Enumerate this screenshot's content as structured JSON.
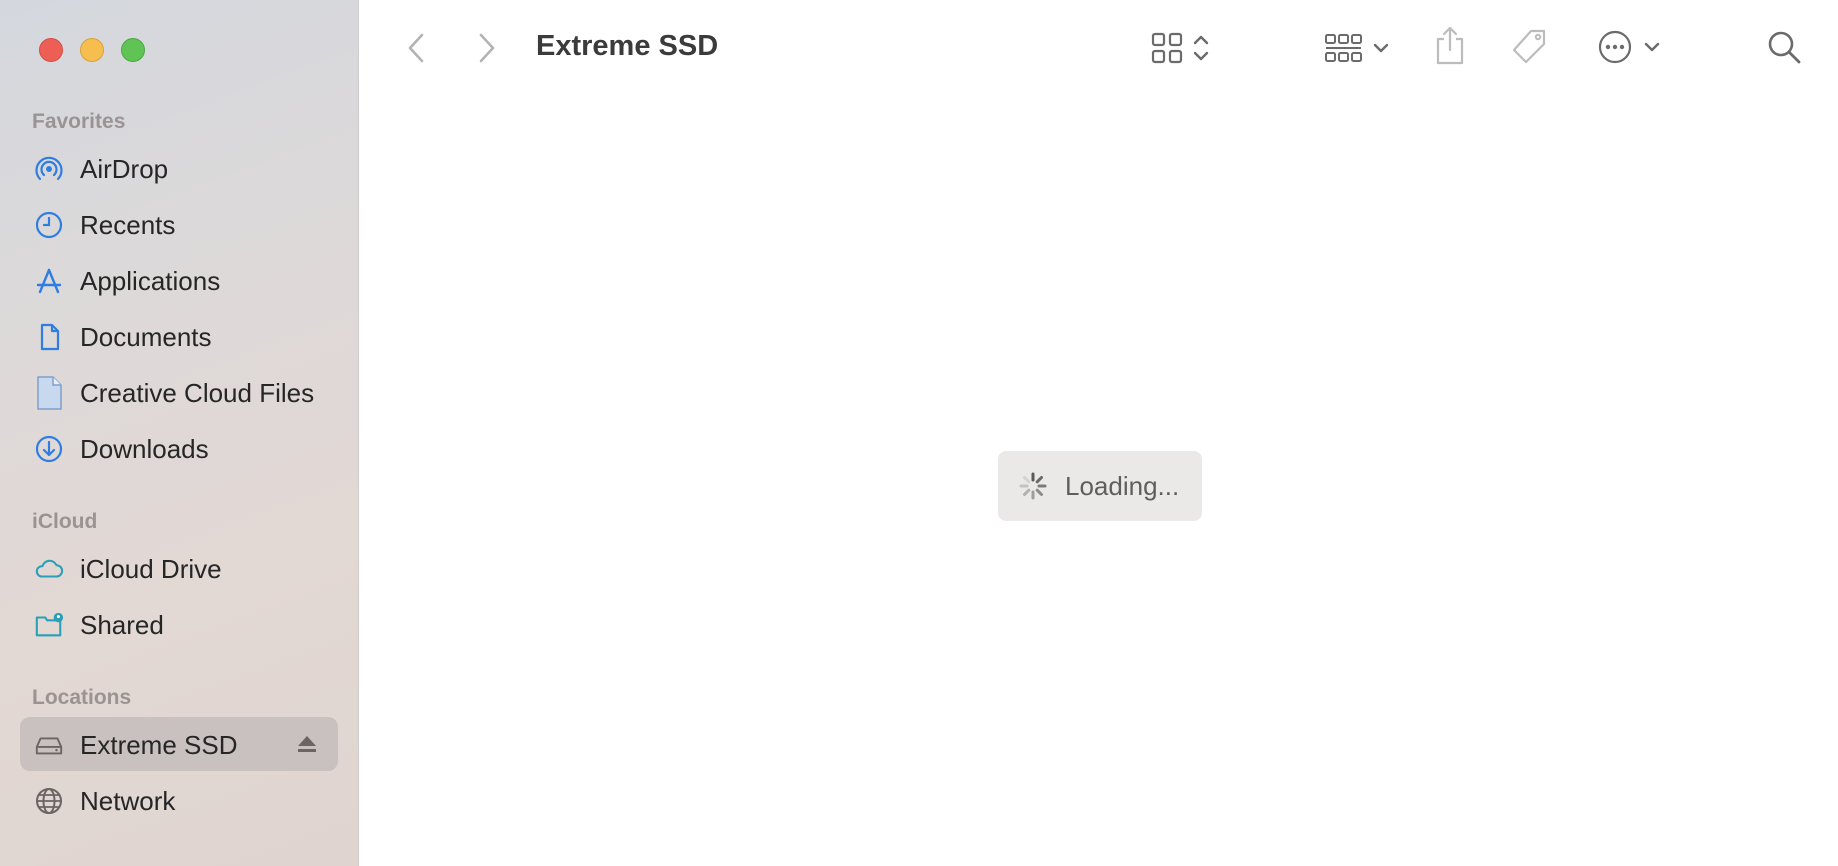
{
  "window": {
    "title": "Extreme SSD"
  },
  "sidebar": {
    "sections": {
      "favorites": "Favorites",
      "icloud": "iCloud",
      "locations": "Locations"
    },
    "favorites": [
      {
        "label": "AirDrop",
        "icon": "airdrop-icon"
      },
      {
        "label": "Recents",
        "icon": "clock-icon"
      },
      {
        "label": "Applications",
        "icon": "applications-icon"
      },
      {
        "label": "Documents",
        "icon": "document-icon"
      },
      {
        "label": "Creative Cloud Files",
        "icon": "file-icon"
      },
      {
        "label": "Downloads",
        "icon": "download-icon"
      }
    ],
    "icloud": [
      {
        "label": "iCloud Drive",
        "icon": "cloud-icon"
      },
      {
        "label": "Shared",
        "icon": "shared-folder-icon"
      }
    ],
    "locations": [
      {
        "label": "Extreme SSD",
        "icon": "drive-icon",
        "selected": true
      },
      {
        "label": "Network",
        "icon": "globe-icon"
      }
    ]
  },
  "main": {
    "loading_text": "Loading..."
  },
  "colors": {
    "accent": "#2f7de1",
    "selected_bg": "#c9c1bf",
    "traffic_close": "#ed5f55",
    "traffic_min": "#f5be4f",
    "traffic_max": "#5fc454"
  }
}
